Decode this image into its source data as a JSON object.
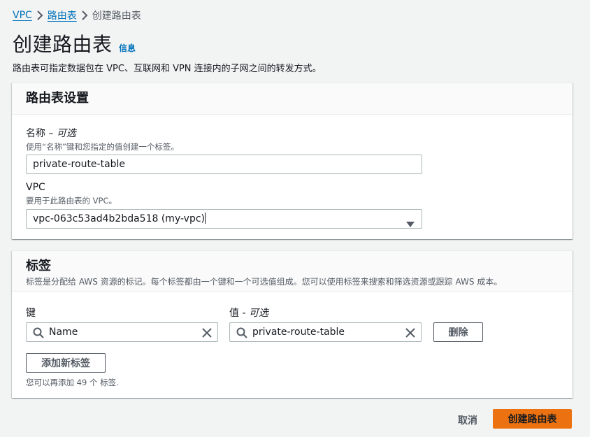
{
  "breadcrumb": {
    "items": [
      "VPC",
      "路由表"
    ],
    "current": "创建路由表"
  },
  "header": {
    "title": "创建路由表",
    "info": "信息",
    "description": "路由表可指定数据包在 VPC、互联网和 VPN 连接内的子网之间的转发方式。"
  },
  "settings": {
    "title": "路由表设置",
    "name": {
      "label": "名称",
      "optional": "– 可选",
      "hint": "使用“名称”键和您指定的值创建一个标签。",
      "value": "private-route-table"
    },
    "vpc": {
      "label": "VPC",
      "hint": "要用于此路由表的 VPC。",
      "selected": "vpc-063c53ad4b2bda518 (my-vpc)"
    }
  },
  "tags": {
    "title": "标签",
    "description": "标签是分配给 AWS 资源的标记。每个标签都由一个键和一个可选值组成。您可以使用标签来搜索和筛选资源或跟踪 AWS 成本。",
    "key_label": "键",
    "value_label": "值",
    "value_optional": "- 可选",
    "rows": [
      {
        "key": "Name",
        "value": "private-route-table"
      }
    ],
    "remove_label": "删除",
    "add_label": "添加新标签",
    "remaining": "您可以再添加 49 个 标签."
  },
  "footer": {
    "cancel": "取消",
    "submit": "创建路由表"
  },
  "colors": {
    "link": "#0073bb",
    "primary": "#ec7211",
    "background": "#f2f3f3"
  },
  "icons": [
    "chevron-right-icon",
    "search-icon",
    "clear-icon",
    "caret-down-icon"
  ]
}
